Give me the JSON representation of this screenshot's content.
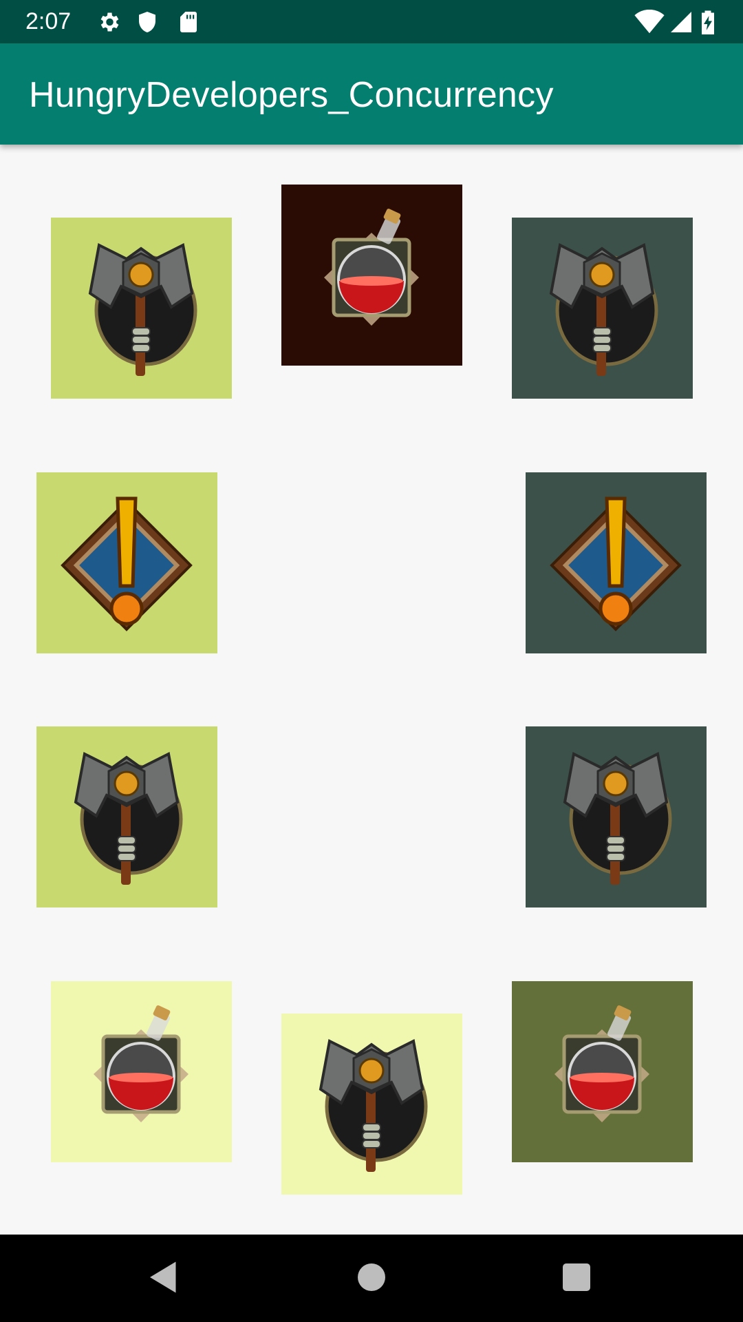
{
  "status_bar": {
    "time": "2:07",
    "left_icons": [
      "gear-icon",
      "shield-icon",
      "sd-card-icon"
    ],
    "right_icons": [
      "wifi-icon",
      "signal-icon",
      "battery-charging-icon"
    ]
  },
  "app_bar": {
    "title": "HungryDevelopers_Concurrency"
  },
  "grid": {
    "tiles": [
      {
        "icon": "axe-icon",
        "background": "#c8d96f"
      },
      {
        "icon": "potion-icon",
        "background": "#2b0c04"
      },
      {
        "icon": "axe-icon",
        "background": "#3b5149"
      },
      {
        "icon": "alert-icon",
        "background": "#c8d96f"
      },
      {
        "icon": "alert-icon",
        "background": "#3b5149"
      },
      {
        "icon": "axe-icon",
        "background": "#c8d96f"
      },
      {
        "icon": "axe-icon",
        "background": "#3b5149"
      },
      {
        "icon": "potion-icon",
        "background": "#f0f8b0"
      },
      {
        "icon": "axe-icon",
        "background": "#f0f8b0"
      },
      {
        "icon": "potion-icon",
        "background": "#647039"
      }
    ]
  },
  "nav_bar": {
    "buttons": [
      "back-icon",
      "home-icon",
      "recents-icon"
    ]
  },
  "colors": {
    "status_bar": "#014f44",
    "app_bar": "#047f6f",
    "background": "#f7f7f7"
  }
}
